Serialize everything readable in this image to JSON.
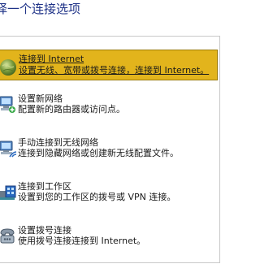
{
  "heading": "择一个连接选项",
  "options": [
    {
      "title": "连接到 Internet",
      "desc": "设置无线、宽带或拨号连接，连接到 Internet。",
      "icon": "globe-icon",
      "selected": true
    },
    {
      "title": "设置新网络",
      "desc": "配置新的路由器或访问点。",
      "icon": "new-network-icon",
      "selected": false
    },
    {
      "title": "手动连接到无线网络",
      "desc": "连接到隐藏网络或创建新无线配置文件。",
      "icon": "wireless-network-icon",
      "selected": false
    },
    {
      "title": "连接到工作区",
      "desc": "设置到您的工作区的拨号或 VPN 连接。",
      "icon": "workplace-icon",
      "selected": false
    },
    {
      "title": "设置拨号连接",
      "desc": "使用拨号连接连接到 Internet。",
      "icon": "dialup-icon",
      "selected": false
    }
  ],
  "colors": {
    "selection": "#e2b41c",
    "heading": "#1e3287"
  }
}
